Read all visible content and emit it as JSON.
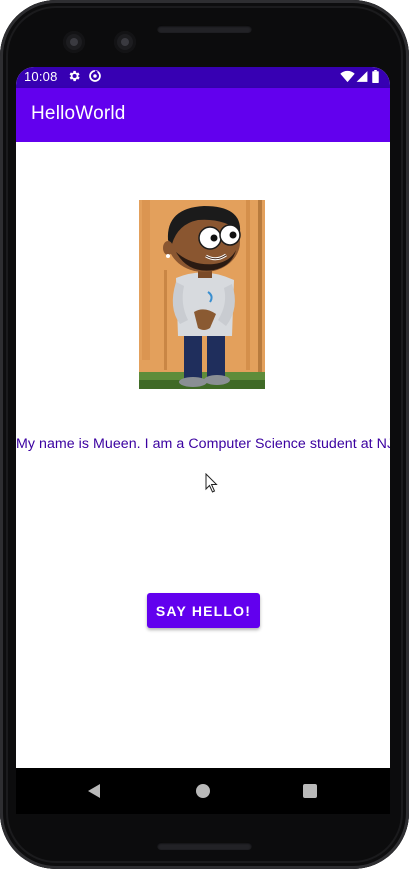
{
  "status_bar": {
    "time": "10:08",
    "background_color": "#3700b3",
    "icons": [
      "gear-icon",
      "sync-icon",
      "wifi-icon",
      "signal-icon",
      "battery-icon"
    ]
  },
  "app_bar": {
    "title": "HelloWorld",
    "background_color": "#6200ee"
  },
  "main": {
    "avatar_image": "cartoon-avatar",
    "intro_text": "My name is Mueen. I am a Computer Science student at NJIT.",
    "intro_color": "#3a00a0",
    "hello_button_label": "SAY HELLO!",
    "button_color": "#6200ee"
  },
  "nav_bar": {
    "icons": [
      "back-icon",
      "home-icon",
      "recents-icon"
    ]
  }
}
